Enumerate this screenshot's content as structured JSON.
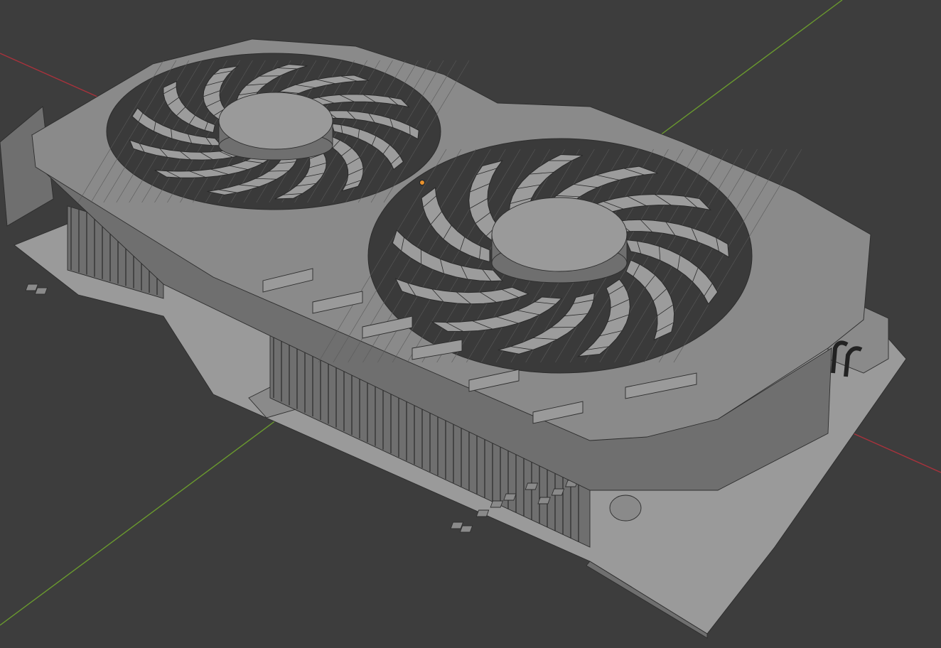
{
  "viewport": {
    "object": "gpu-cooler-model",
    "background_color": "#3d3d3d",
    "mesh_color": "#8c8c8c",
    "wire_color": "#2a2a2a",
    "x_axis_color": "#a8323c",
    "y_axis_color": "#6a9a2e",
    "origin_color": "#e8922e",
    "fans": [
      {
        "name": "fan-small",
        "blades": 13
      },
      {
        "name": "fan-large",
        "blades": 13
      }
    ]
  }
}
